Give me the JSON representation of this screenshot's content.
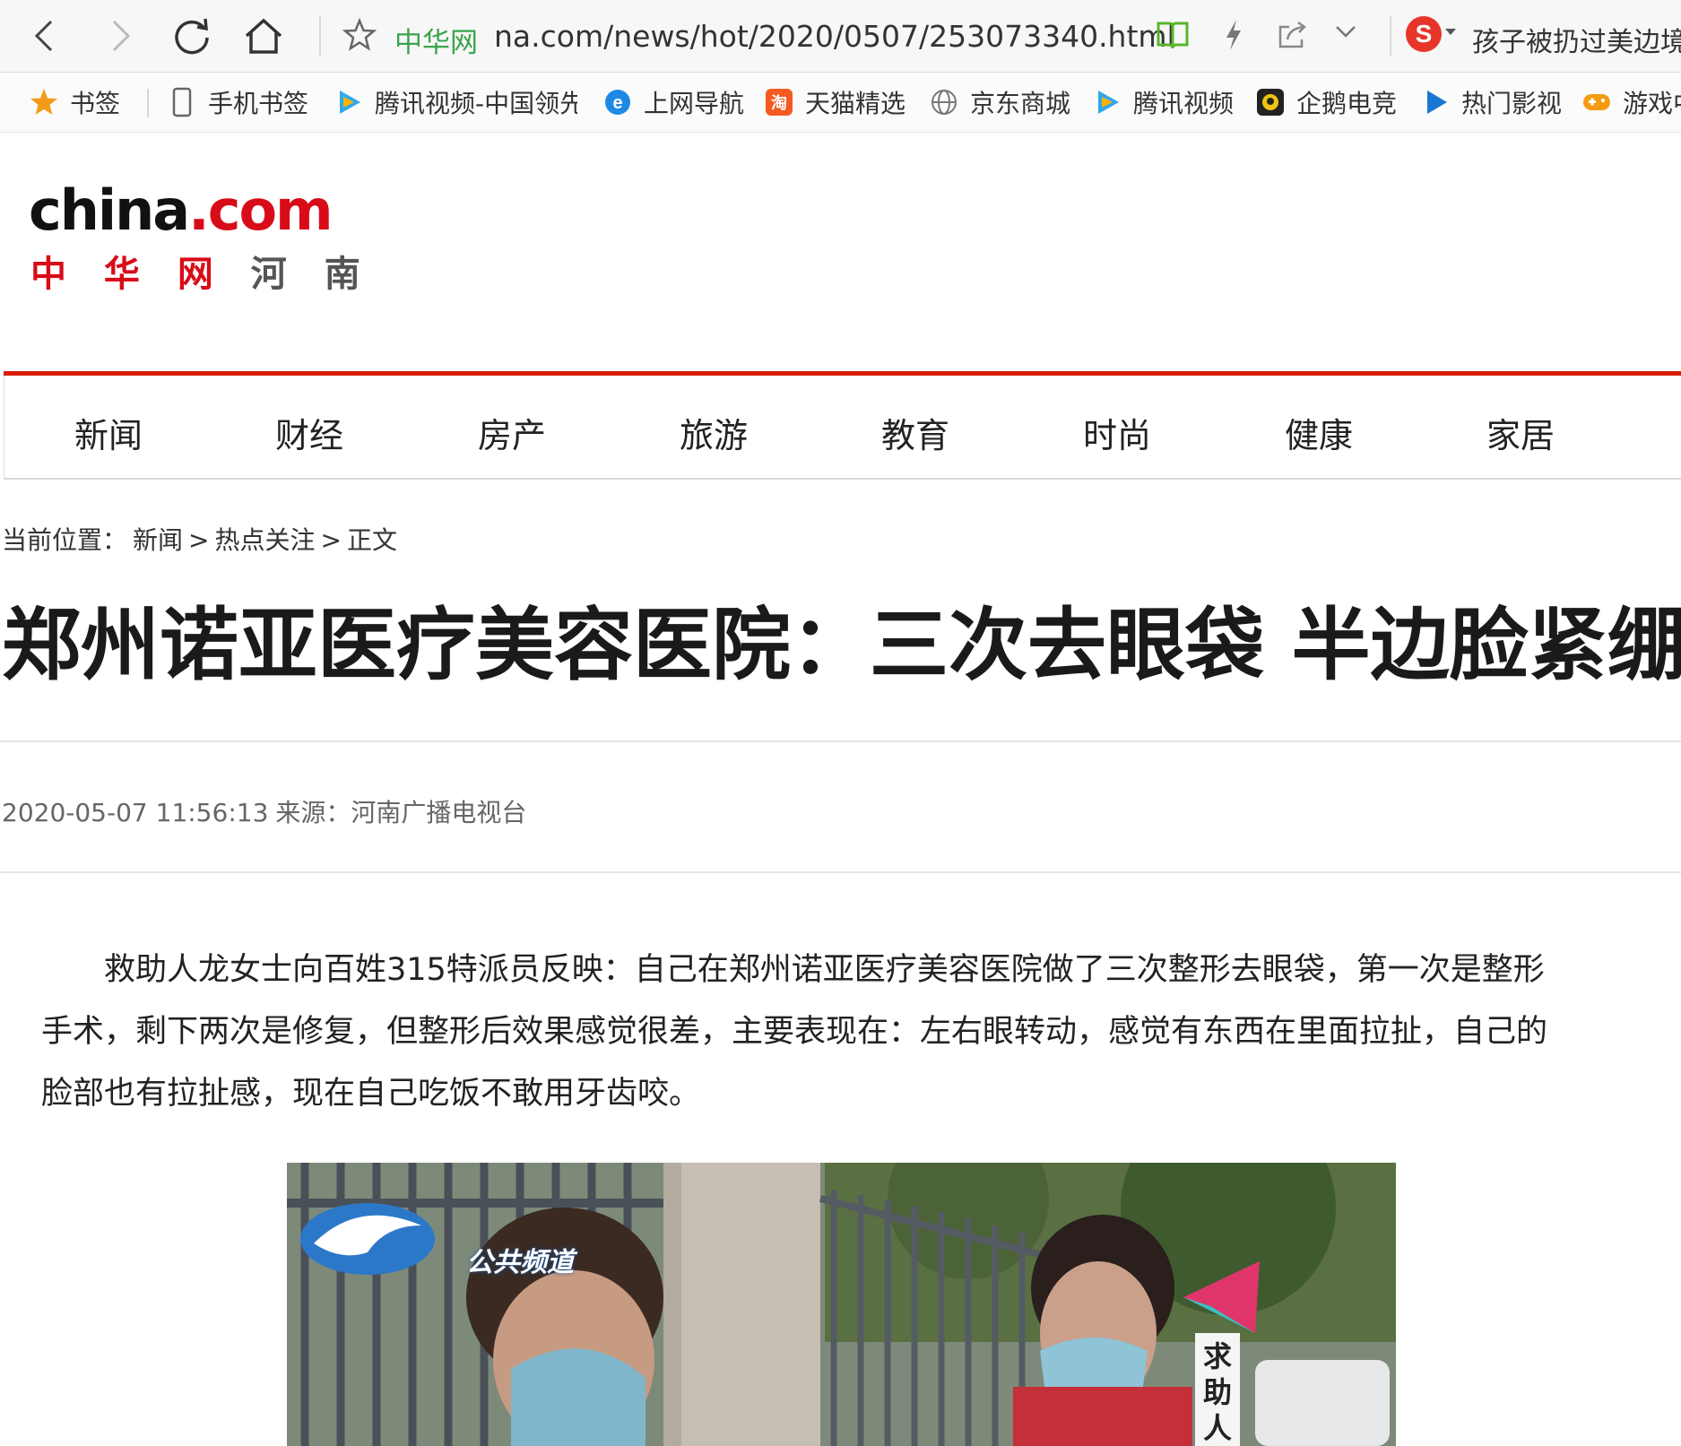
{
  "browser": {
    "site_name": "中华网",
    "url": "na.com/news/hot/2020/0507/253073340.html",
    "search_text": "孩子被扔过美边境",
    "search_engine_logo": "S"
  },
  "bookmarks": [
    {
      "label": "书签",
      "icon": "star-icon"
    },
    {
      "label": "手机书签",
      "icon": "phone-icon"
    },
    {
      "label": "腾讯视频-中国领先",
      "icon": "tencent-video-icon"
    },
    {
      "label": "上网导航",
      "icon": "ie-icon"
    },
    {
      "label": "天猫精选",
      "icon": "taobao-icon"
    },
    {
      "label": "京东商城",
      "icon": "globe-icon"
    },
    {
      "label": "腾讯视频",
      "icon": "tencent-video-icon"
    },
    {
      "label": "企鹅电竞",
      "icon": "penguin-esports-icon"
    },
    {
      "label": "热门影视",
      "icon": "play-icon"
    },
    {
      "label": "游戏中",
      "icon": "gamepad-icon"
    }
  ],
  "site": {
    "logo_en": {
      "china": "china",
      "dot": ".",
      "com": "com"
    },
    "logo_cn": {
      "red": "中 华 网",
      "gray": "河 南"
    }
  },
  "nav": [
    "新闻",
    "财经",
    "房产",
    "旅游",
    "教育",
    "时尚",
    "健康",
    "家居"
  ],
  "breadcrumb": {
    "prefix": "当前位置：",
    "items": [
      "新闻",
      "热点关注",
      "正文"
    ],
    "separator": ">"
  },
  "article": {
    "title": "郑州诺亚医疗美容医院：三次去眼袋 半边脸紧绷",
    "date": "2020-05-07 11:56:13",
    "source_label": "来源：",
    "source": "河南广播电视台",
    "paragraph": "救助人龙女士向百姓315特派员反映：自己在郑州诺亚医疗美容医院做了三次整形去眼袋，第一次是整形手术，剩下两次是修复，但整形后效果感觉很差，主要表现在：左右眼转动，感觉有东西在里面拉扯，自己的脸部也有拉扯感，现在自己吃饭不敢用牙齿咬。"
  },
  "photo": {
    "channel_logo_text": "公共频道",
    "caption_vertical": "求助人"
  },
  "colors": {
    "brand_red": "#d81e06",
    "site_name_green": "#3aa54a"
  }
}
